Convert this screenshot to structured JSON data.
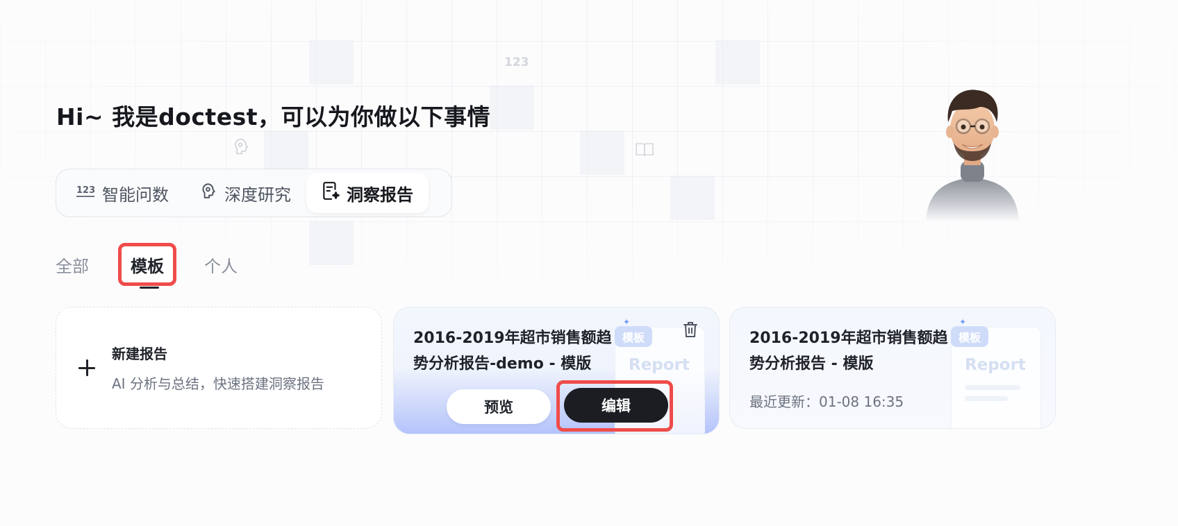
{
  "greeting": "Hi~ 我是doctest，可以为你做以下事情",
  "modes": [
    {
      "label": "智能问数",
      "icon": "123-icon"
    },
    {
      "label": "深度研究",
      "icon": "brain-icon"
    },
    {
      "label": "洞察报告",
      "icon": "report-icon",
      "active": true
    }
  ],
  "filter_tabs": [
    {
      "label": "全部"
    },
    {
      "label": "模板",
      "active": true
    },
    {
      "label": "个人"
    }
  ],
  "new_report": {
    "title": "新建报告",
    "description": "AI 分析与总结，快速搭建洞察报告"
  },
  "cards": [
    {
      "title": "2016-2019年超市销售额趋势分析报告-demo - 模版",
      "tag": "模板",
      "thumb_word": "Report",
      "preview_label": "预览",
      "edit_label": "编辑"
    },
    {
      "title": "2016-2019年超市销售额趋势分析报告 - 模版",
      "tag": "模板",
      "thumb_word": "Report",
      "updated": "最近更新：01-08 16:35"
    }
  ],
  "background_decor": {
    "label_123": "123"
  },
  "colors": {
    "highlight": "#ef4c4a",
    "primary_button": "#1b1d22",
    "card_gradient_end": "#b3c3fc",
    "tag_bg": "#cfdcf9"
  }
}
